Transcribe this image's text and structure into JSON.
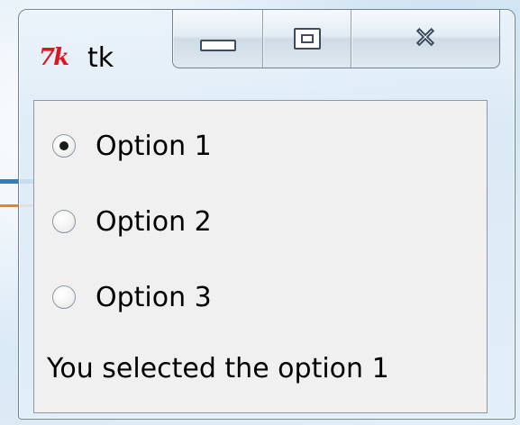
{
  "window": {
    "title": "tk",
    "app_icon": "tk-feather-icon",
    "icon_text": "7k"
  },
  "caption_buttons": [
    {
      "name": "minimize",
      "icon": "minimize-icon"
    },
    {
      "name": "maximize",
      "icon": "maximize-icon"
    },
    {
      "name": "close",
      "icon": "close-icon",
      "glyph": "✕"
    }
  ],
  "radio_options": [
    {
      "label": "Option 1",
      "checked": true
    },
    {
      "label": "Option 2",
      "checked": false
    },
    {
      "label": "Option 3",
      "checked": false
    }
  ],
  "status": {
    "text": "You selected the option 1"
  },
  "colors": {
    "icon_red": "#e0141e",
    "client_bg": "#f0f0f0"
  }
}
